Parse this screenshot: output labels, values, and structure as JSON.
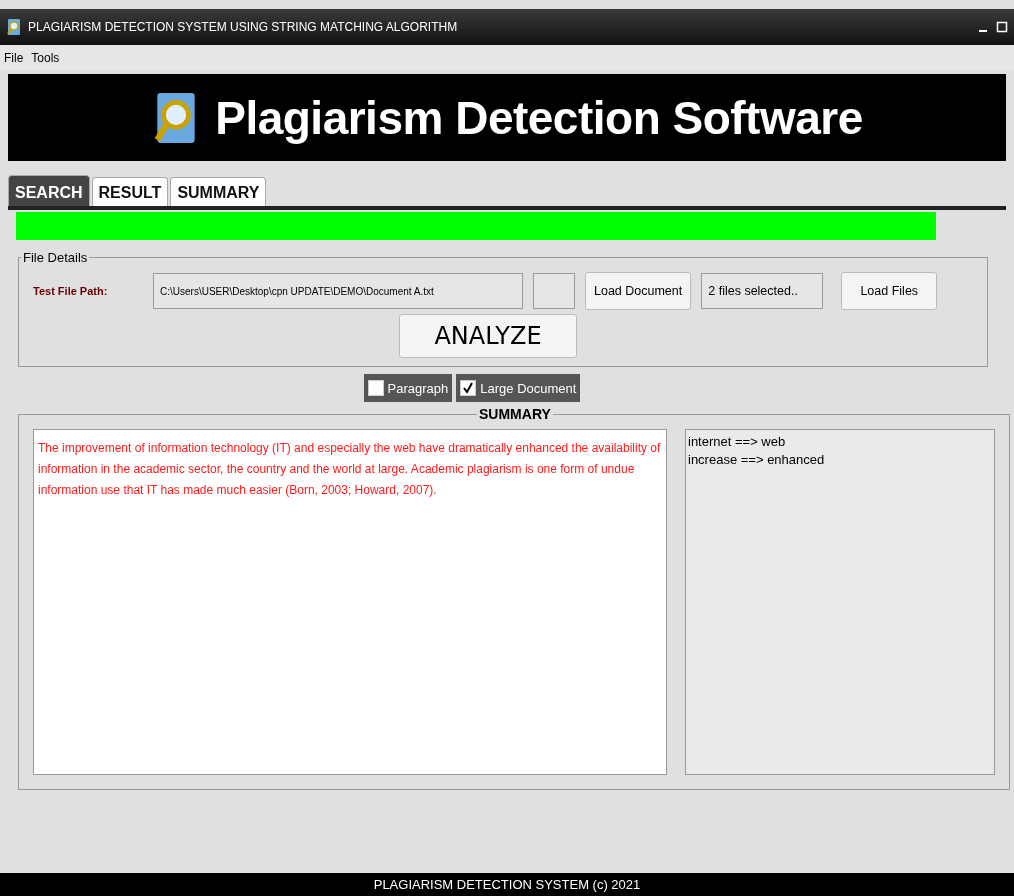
{
  "window": {
    "title": "PLAGIARISM DETECTION SYSTEM USING STRING MATCHING ALGORITHM"
  },
  "menu": [
    "File",
    "Tools"
  ],
  "banner": {
    "title": "Plagiarism Detection Software"
  },
  "tabs": [
    {
      "label": "SEARCH",
      "selected": true
    },
    {
      "label": "RESULT",
      "selected": false
    },
    {
      "label": "SUMMARY",
      "selected": false
    }
  ],
  "file_details": {
    "legend": "File Details",
    "path_label": "Test File Path:",
    "path_value": "C:\\Users\\USER\\Desktop\\cpn UPDATE\\DEMO\\Document A.txt",
    "load_document": "Load Document",
    "files_value": "2 files selected..",
    "load_files": "Load Files",
    "analyze": "ANALYZE"
  },
  "options": [
    {
      "label": "Paragraph",
      "checked": false
    },
    {
      "label": "Large Document",
      "checked": true
    }
  ],
  "summary": {
    "legend": "SUMMARY",
    "text": "The improvement of information technology (IT) and especially the web have dramatically enhanced the availability of information in the academic sector, the country and the world at large. Academic plagiarism is one form of undue information use that IT has made much easier (Born, 2003; Howard, 2007).",
    "replacements": [
      "internet ==> web",
      "increase ==> enhanced"
    ]
  },
  "status_bar": "PLAGIARISM DETECTION SYSTEM (c) 2021"
}
